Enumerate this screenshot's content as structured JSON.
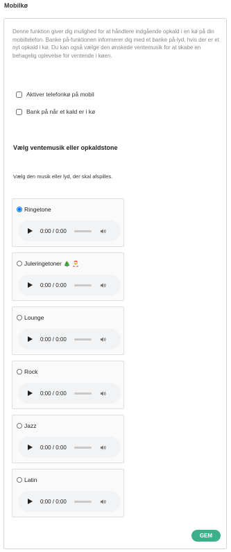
{
  "section": {
    "title": "Mobilkø"
  },
  "description": "Denne funktion giver dig mulighed for at håndtere indgående opkald i en kø på din mobiltelefon. Banke på-funktionen informerer dig med et banke på-lyd, hvis der er et nyt opkald i kø. Du kan også vælge den ønskede ventemusik for at skabe en behagelig oplevelse for ventende i køen.",
  "options": {
    "activate_queue": {
      "label": "Aktiver telefonkø på mobil",
      "checked": false
    },
    "call_waiting": {
      "label": "Bank på når et kald er i kø",
      "checked": false
    }
  },
  "music": {
    "heading": "Vælg ventemusik eller opkaldstone",
    "help": "Vælg den musik eller lyd, der skal afspilles.",
    "items": [
      {
        "label": "Ringetone",
        "selected": true,
        "time": "0:00 / 0:00"
      },
      {
        "label": "Juleringetoner",
        "selected": false,
        "time": "0:00 / 0:00",
        "emoji": "🎄 🎅"
      },
      {
        "label": "Lounge",
        "selected": false,
        "time": "0:00 / 0:00"
      },
      {
        "label": "Rock",
        "selected": false,
        "time": "0:00 / 0:00"
      },
      {
        "label": "Jazz",
        "selected": false,
        "time": "0:00 / 0:00"
      },
      {
        "label": "Latin",
        "selected": false,
        "time": "0:00 / 0:00"
      }
    ]
  },
  "actions": {
    "save_label": "GEM"
  },
  "colors": {
    "accent": "#3caf8b",
    "border": "#cfd6dc",
    "player_bg": "#f1f3f4"
  }
}
